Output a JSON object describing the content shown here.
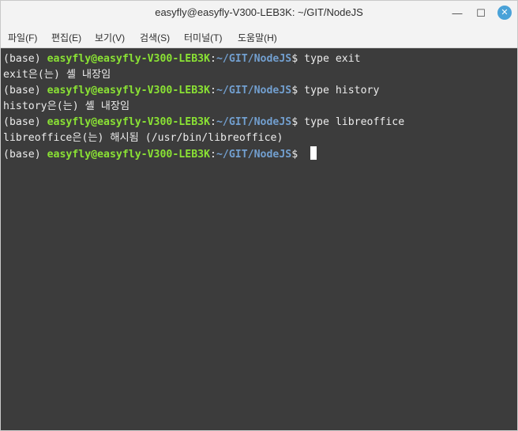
{
  "window": {
    "title": "easyfly@easyfly-V300-LEB3K: ~/GIT/NodeJS",
    "minimize_glyph": "—",
    "maximize_glyph": "☐",
    "close_glyph": "✕"
  },
  "menu": {
    "items": [
      {
        "label": "파일(F)"
      },
      {
        "label": "편집(E)"
      },
      {
        "label": "보기(V)"
      },
      {
        "label": "검색(S)"
      },
      {
        "label": "터미널(T)"
      },
      {
        "label": "도움말(H)"
      }
    ]
  },
  "terminal": {
    "prompt": {
      "env": "(base) ",
      "user_host": "easyfly@easyfly-V300-LEB3K",
      "colon": ":",
      "path": "~/GIT/NodeJS",
      "symbol": "$ "
    },
    "lines": [
      {
        "command": "type exit"
      },
      {
        "output": "exit은(는) 셸 내장임"
      },
      {
        "command": "type history"
      },
      {
        "output": "history은(는) 셸 내장임"
      },
      {
        "command": "type libreoffice"
      },
      {
        "output": "libreoffice은(는) 해시됨 (/usr/bin/libreoffice)"
      }
    ]
  },
  "colors": {
    "terminal_bg": "#3c3c3c",
    "user_host": "#8ae234",
    "path": "#729fcf",
    "text": "#ececec",
    "close_button": "#4aa2d8"
  }
}
